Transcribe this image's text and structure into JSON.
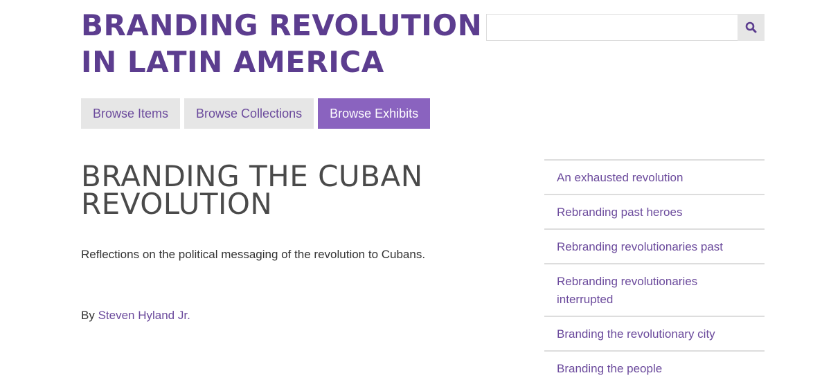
{
  "site": {
    "title": "BRANDING REVOLUTION IN LATIN AMERICA"
  },
  "search": {
    "value": "",
    "placeholder": "",
    "button_icon": "search-icon"
  },
  "nav": {
    "items": [
      {
        "label": "Browse Items",
        "active": false
      },
      {
        "label": "Browse Collections",
        "active": false
      },
      {
        "label": "Browse Exhibits",
        "active": true
      }
    ]
  },
  "exhibit": {
    "title": "BRANDING THE CUBAN REVOLUTION",
    "description": "Reflections on the political messaging of the revolution to Cubans.",
    "credits_prefix": "By ",
    "credits_author": "Steven Hyland Jr."
  },
  "exhibit_nav": {
    "pages": [
      {
        "label": "An exhausted revolution"
      },
      {
        "label": "Rebranding past heroes"
      },
      {
        "label": "Rebranding revolutionaries past"
      },
      {
        "label": "Rebranding revolutionaries interrupted"
      },
      {
        "label": "Branding the revolutionary city"
      },
      {
        "label": "Branding the people"
      }
    ]
  },
  "colors": {
    "brand": "#5c3d8f",
    "link": "#6b4a9c",
    "active_tab": "#8a63bf",
    "tab_background": "#e6e6e6",
    "heading": "#4a4a4a"
  }
}
